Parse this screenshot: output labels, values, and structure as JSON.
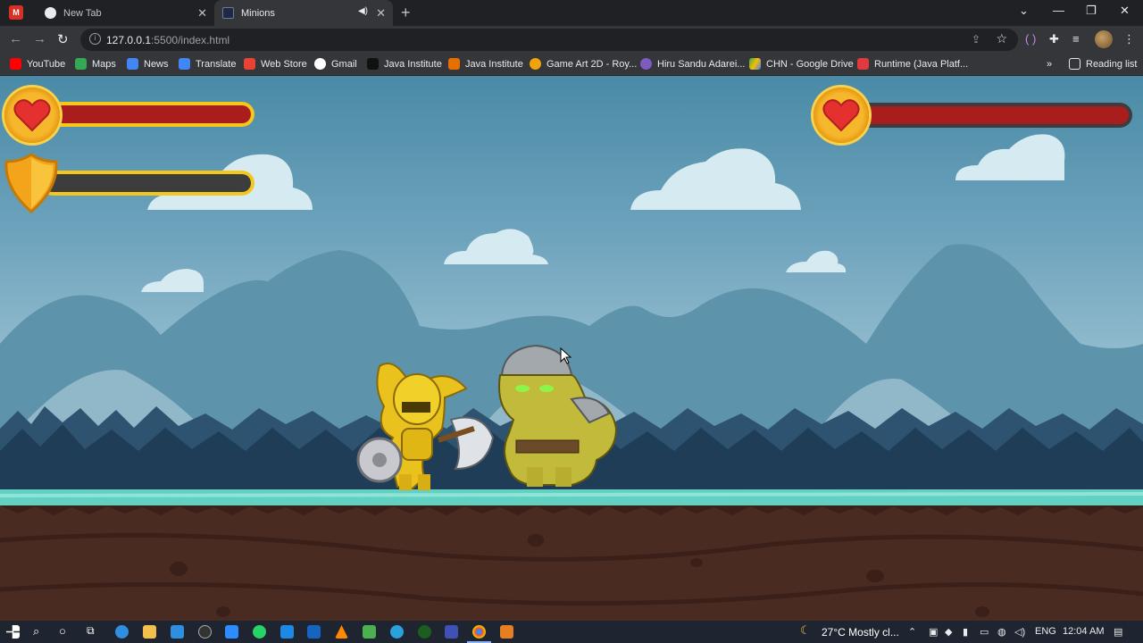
{
  "browser": {
    "tabs": [
      {
        "title": "New Tab"
      },
      {
        "title": "Minions"
      }
    ],
    "url_host": "127.0.0.1",
    "url_rest": ":5500/index.html",
    "bookmarks": [
      {
        "label": "YouTube",
        "icon": "youtube-icon",
        "color": "#ff0000"
      },
      {
        "label": "Maps",
        "icon": "maps-icon",
        "color": "#34a853"
      },
      {
        "label": "News",
        "icon": "news-icon",
        "color": "#4285f4"
      },
      {
        "label": "Translate",
        "icon": "translate-icon",
        "color": "#4285f4"
      },
      {
        "label": "Web Store",
        "icon": "webstore-icon",
        "color": "#ea4335"
      },
      {
        "label": "Gmail",
        "icon": "google-icon",
        "color": "#ffffff"
      },
      {
        "label": "Java Institute",
        "icon": "house-icon",
        "color": "#202124"
      },
      {
        "label": "Java Institute",
        "icon": "java-icon",
        "color": "#e76f00"
      },
      {
        "label": "Game Art 2D - Roy...",
        "icon": "gameart-icon",
        "color": "#f0a30a"
      },
      {
        "label": "Hiru Sandu Adarei...",
        "icon": "profile-icon",
        "color": "#7c5cbf"
      },
      {
        "label": "CHN - Google Drive",
        "icon": "drive-icon",
        "color": "#fbbc04"
      },
      {
        "label": "Runtime (Java Platf...",
        "icon": "oracle-icon",
        "color": "#e03a3e"
      }
    ],
    "reading_list": "Reading list"
  },
  "game": {
    "player": {
      "health": 1.0,
      "shield": 0.0
    },
    "enemy": {
      "health": 1.0
    },
    "colors": {
      "health": "#a91d1d",
      "frame": "#f5c71a",
      "shield_empty": "#3d3d3d",
      "grass": "#63d1c2",
      "soil": "#4a2b22"
    }
  },
  "taskbar": {
    "weather": "27°C  Mostly cl...",
    "lang": "ENG",
    "time": "12:04 AM"
  }
}
